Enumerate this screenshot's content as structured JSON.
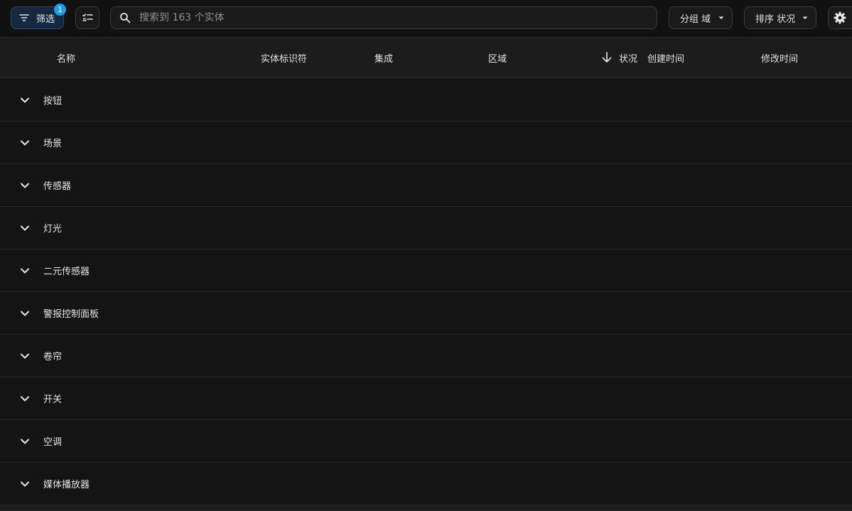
{
  "toolbar": {
    "filter_label": "筛选",
    "filter_badge": "1",
    "search_placeholder": "搜索到 163 个实体",
    "group_label": "分组 域",
    "sort_label": "排序 状况"
  },
  "table": {
    "columns": {
      "name": "名称",
      "entity_id": "实体标识符",
      "integration": "集成",
      "area": "区域",
      "status": "状况",
      "created": "创建时间",
      "modified": "修改时间"
    },
    "groups": [
      {
        "label": "按钮"
      },
      {
        "label": "场景"
      },
      {
        "label": "传感器"
      },
      {
        "label": "灯光"
      },
      {
        "label": "二元传感器"
      },
      {
        "label": "警报控制面板"
      },
      {
        "label": "卷帘"
      },
      {
        "label": "开关"
      },
      {
        "label": "空调"
      },
      {
        "label": "媒体播放器"
      }
    ]
  },
  "colors": {
    "background": "#111111",
    "header_bg": "#1c1c1c",
    "accent": "#1e9be9",
    "filter_bg": "#14293f"
  },
  "icons": [
    "filter-icon",
    "multiselect-icon",
    "search-icon",
    "caret-down-icon",
    "gear-icon",
    "arrow-down-icon",
    "chevron-down-icon"
  ]
}
